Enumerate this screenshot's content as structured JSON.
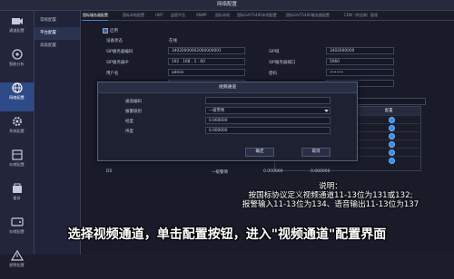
{
  "window": {
    "title": "网络配置"
  },
  "sidebar": {
    "items": [
      {
        "label": "通道配置",
        "icon": "camera-icon"
      },
      {
        "label": "智能分析",
        "icon": "analytics-icon"
      },
      {
        "label": "网络配置",
        "icon": "globe-icon",
        "active": true
      },
      {
        "label": "系统配置",
        "icon": "gear-icon"
      },
      {
        "label": "存储配置",
        "icon": "storage-icon"
      },
      {
        "label": "备份",
        "icon": "backup-icon"
      },
      {
        "label": "存储配置",
        "icon": "disk-icon"
      },
      {
        "label": "报警配置",
        "icon": "alarm-icon"
      },
      {
        "label": "系统维护",
        "icon": "maintenance-icon"
      }
    ]
  },
  "submenu": {
    "items": [
      {
        "label": "常规配置"
      },
      {
        "label": "平台配置",
        "active": true
      },
      {
        "label": "高级配置"
      }
    ]
  },
  "tabs": [
    "国标服务器配置",
    "国标本地配置",
    "UNT",
    "监管平台",
    "SNMP",
    "国标本地",
    "国标GA/T1400本地配置",
    "国标GA/T1400服务器配置",
    "CDN（供应商）管理"
  ],
  "form": {
    "enable_label": "启用",
    "device_status_label": "设备状态",
    "device_status_value": "在线",
    "sip_server_id_label": "SIP服务器编码",
    "sip_server_id_value": "34020000002000000001",
    "sip_domain_label": "SIP域",
    "sip_domain_value": "3402000000",
    "sip_server_ip_label": "SIP服务器IP",
    "sip_server_ip_value": "192 . 168 . 1 . 60",
    "sip_server_port_label": "SIP服务器端口",
    "sip_server_port_value": "5060",
    "username_label": "用户名",
    "username_value": "admin",
    "password_label": "密码",
    "password_value": "••••••"
  },
  "grid": {
    "header_config": "配置",
    "visible_row_label": "D5",
    "visible_row_level": "一级警情",
    "visible_row_value": "0.000000"
  },
  "dialog": {
    "title": "视频通道",
    "channel_id_label": "通道编码",
    "channel_id_value": "",
    "alarm_level_label": "报警级别",
    "alarm_level_value": "一级警情",
    "longitude_label": "经度",
    "longitude_value": "0.000000",
    "latitude_label": "纬度",
    "latitude_value": "0.000000",
    "ok_label": "确定",
    "cancel_label": "取消"
  },
  "annotation": {
    "title": "说明：",
    "line1": "按国标协议定义视频通道11-13位为131或132;",
    "line2": "报警输入11-13位为134、语音输出11-13位为137"
  },
  "caption": "选择视频通道，单击配置按钮，进入\"视频通道\"配置界面",
  "colors": {
    "accent": "#3b8de0",
    "active_nav": "#2f4a88"
  }
}
